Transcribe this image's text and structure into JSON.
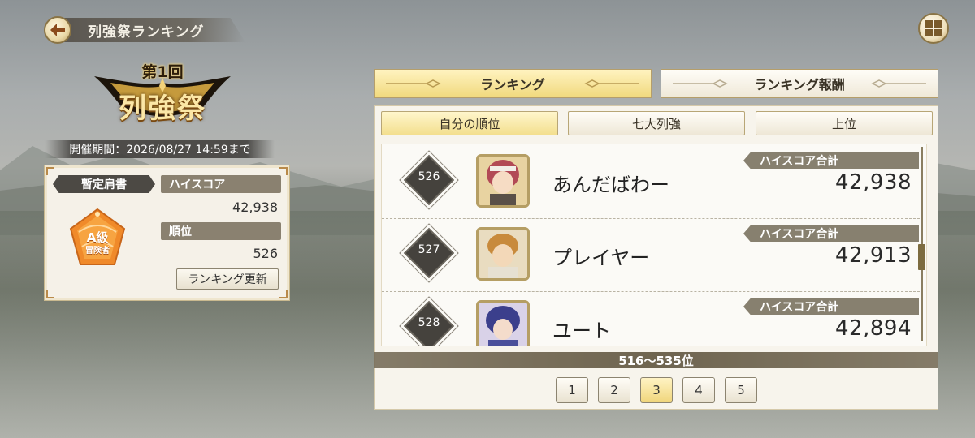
{
  "header": {
    "title": "列強祭ランキング",
    "back_icon": "arrow-left-icon",
    "menu_icon": "grid-menu-icon"
  },
  "event": {
    "round": "第1回",
    "name": "列強祭",
    "period": "開催期間：2026/08/27 14:59まで"
  },
  "left_panel": {
    "title_tag": "暫定肩書",
    "badge_rank": "A級",
    "badge_subtitle": "冒険者",
    "highscore_label": "ハイスコア",
    "highscore_value": "42,938",
    "rank_label": "順位",
    "rank_value": "526",
    "update_button": "ランキング更新"
  },
  "main_tabs": [
    {
      "label": "ランキング",
      "active": true
    },
    {
      "label": "ランキング報酬",
      "active": false
    }
  ],
  "sub_tabs": [
    {
      "label": "自分の順位",
      "active": true
    },
    {
      "label": "七大列強",
      "active": false
    },
    {
      "label": "上位",
      "active": false
    }
  ],
  "rows": [
    {
      "rank": "526",
      "name": "あんだばわー",
      "score_label": "ハイスコア合計",
      "score": "42,938"
    },
    {
      "rank": "527",
      "name": "プレイヤー",
      "score_label": "ハイスコア合計",
      "score": "42,913"
    },
    {
      "rank": "528",
      "name": "ユート",
      "score_label": "ハイスコア合計",
      "score": "42,894"
    }
  ],
  "range_label": "516〜535位",
  "pagination": {
    "pages": [
      "1",
      "2",
      "3",
      "4",
      "5"
    ],
    "current": "3"
  },
  "colors": {
    "accent_gold": "#f1d97d",
    "dark_pill": "#4c4944",
    "score_pill": "#87806f"
  }
}
